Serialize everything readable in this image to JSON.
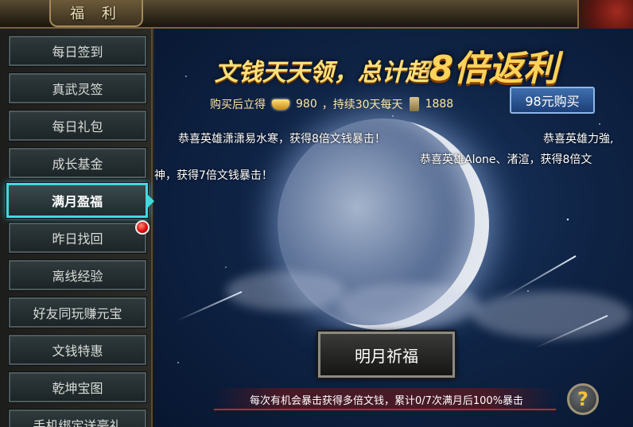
{
  "window": {
    "title": "福 利"
  },
  "sidebar": {
    "items": [
      {
        "label": "每日签到"
      },
      {
        "label": "真武灵签"
      },
      {
        "label": "每日礼包"
      },
      {
        "label": "成长基金"
      },
      {
        "label": "满月盈福",
        "active": true
      },
      {
        "label": "昨日找回",
        "badge": "red-dot"
      },
      {
        "label": "离线经验"
      },
      {
        "label": "好友同玩赚元宝"
      },
      {
        "label": "文钱特惠"
      },
      {
        "label": "乾坤宝图"
      },
      {
        "label": "手机绑定送豪礼"
      }
    ]
  },
  "main": {
    "headline": {
      "part1": "文钱天天领，总计超",
      "part2": "8倍返利"
    },
    "buy_info": {
      "prefix": "购买后立得",
      "ingot_amount": "980",
      "middle": "，持续30天每天",
      "coin_amount": "1888"
    },
    "buy_button": "98元购买",
    "tickers": [
      "恭喜英雄潇潇易水寒，获得8倍文钱暴击！",
      "恭喜英雄力強,",
      "恭喜英雄Alone、渚渲，获得8倍文",
      "神，获得7倍文钱暴击！"
    ],
    "pray_button": "明月祈福",
    "bottom_text": "每次有机会暴击获得多倍文钱，累计0/7次满月后100%暴击",
    "help_icon": "?"
  },
  "colors": {
    "active_border": "#42d9e0",
    "headline_gold": "#ffd35a",
    "buy_button": "#2a5590"
  }
}
